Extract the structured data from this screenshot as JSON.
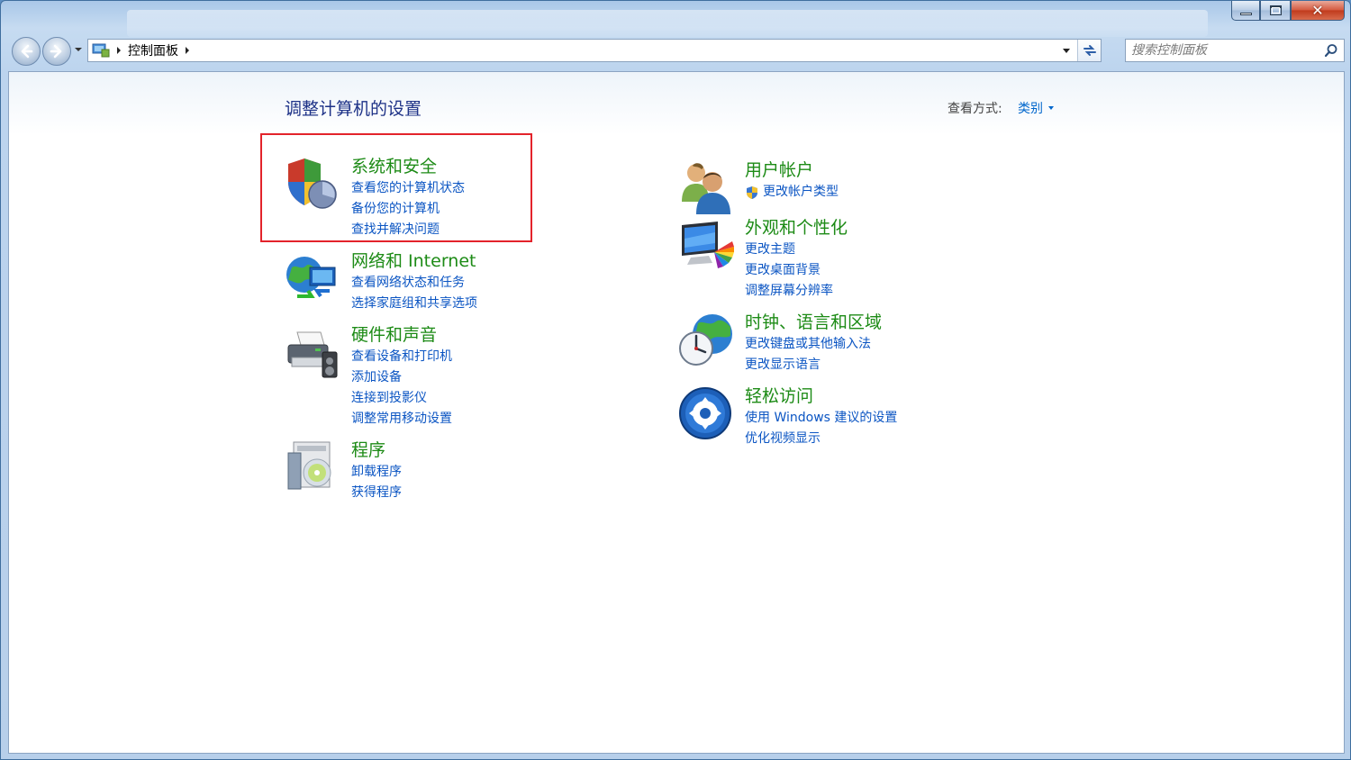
{
  "address_bar": {
    "crumb": "控制面板"
  },
  "search": {
    "placeholder": "搜索控制面板"
  },
  "page": {
    "title": "调整计算机的设置",
    "view_by_label": "查看方式:",
    "view_by_value": "类别"
  },
  "left_categories": [
    {
      "title": "系统和安全",
      "icon": "shield-icon",
      "links": [
        "查看您的计算机状态",
        "备份您的计算机",
        "查找并解决问题"
      ]
    },
    {
      "title": "网络和 Internet",
      "icon": "network-globe-icon",
      "links": [
        "查看网络状态和任务",
        "选择家庭组和共享选项"
      ]
    },
    {
      "title": "硬件和声音",
      "icon": "printer-icon",
      "links": [
        "查看设备和打印机",
        "添加设备",
        "连接到投影仪",
        "调整常用移动设置"
      ]
    },
    {
      "title": "程序",
      "icon": "programs-disc-icon",
      "links": [
        "卸载程序",
        "获得程序"
      ]
    }
  ],
  "right_categories": [
    {
      "title": "用户帐户",
      "icon": "users-icon",
      "links": [
        "更改帐户类型"
      ]
    },
    {
      "title": "外观和个性化",
      "icon": "monitor-palette-icon",
      "links": [
        "更改主题",
        "更改桌面背景",
        "调整屏幕分辨率"
      ]
    },
    {
      "title": "时钟、语言和区域",
      "icon": "clock-globe-icon",
      "links": [
        "更改键盘或其他输入法",
        "更改显示语言"
      ]
    },
    {
      "title": "轻松访问",
      "icon": "ease-of-access-icon",
      "links": [
        "使用 Windows 建议的设置",
        "优化视频显示"
      ]
    }
  ],
  "colors": {
    "category_title": "#1d8b16",
    "link": "#0b55c3",
    "page_title": "#1e3287",
    "highlight_box": "#e3232b"
  }
}
